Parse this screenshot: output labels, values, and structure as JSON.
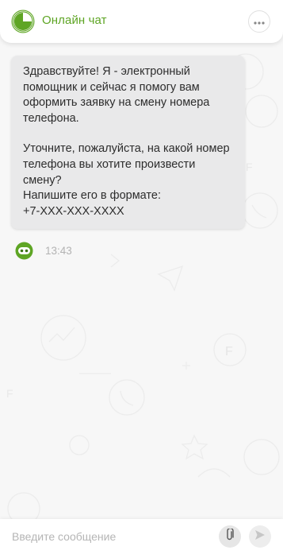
{
  "header": {
    "title": "Онлайн чат",
    "logo_icon": "brand-ring-icon",
    "menu_icon": "more-horizontal-icon"
  },
  "messages": [
    {
      "author": "bot",
      "paragraphs": [
        "Здравствуйте! Я - электронный помощник и сейчас я помогу вам оформить заявку на смену номера телефона.",
        "Уточните, пожалуйста, на какой номер телефона вы хотите произвести смену?\nНапишите его в формате:\n+7-XXX-XXX-XXXX"
      ],
      "time": "13:43"
    }
  ],
  "composer": {
    "placeholder": "Введите сообщение",
    "value": "",
    "attach_icon": "paperclip-icon",
    "send_icon": "send-arrow-icon"
  },
  "colors": {
    "accent": "#5ea524",
    "bubble": "#e9e9ea",
    "background": "#f7f7f7"
  }
}
